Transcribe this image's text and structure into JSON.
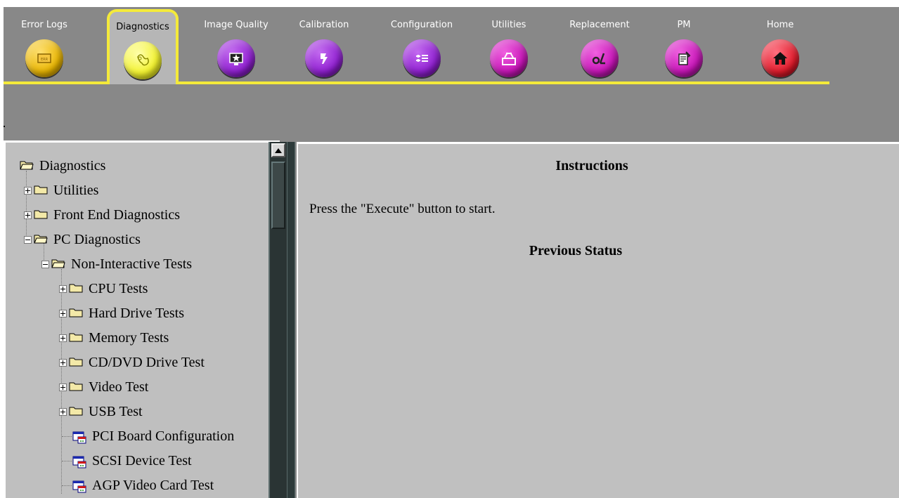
{
  "colors": {
    "accent_yellow": "#f4ea3a",
    "panel_gray": "#888888",
    "tree_bg": "#bfbfbf",
    "tab_orange": "#e8b400",
    "tab_active": "#f2f230",
    "tab_purple": "#8f1fd0",
    "tab_magenta": "#c614b6",
    "tab_red": "#e01a2a"
  },
  "tabs": [
    {
      "label": "Error Logs",
      "icon": "error-log-icon"
    },
    {
      "label": "Diagnostics",
      "icon": "diagnostics-icon",
      "active": true
    },
    {
      "label": "Image Quality",
      "icon": "image-quality-icon"
    },
    {
      "label": "Calibration",
      "icon": "calibration-icon"
    },
    {
      "label": "Configuration",
      "icon": "configuration-icon"
    },
    {
      "label": "Utilities",
      "icon": "utilities-icon"
    },
    {
      "label": "Replacement",
      "icon": "replacement-icon"
    },
    {
      "label": "PM",
      "icon": "pm-icon"
    },
    {
      "label": "Home",
      "icon": "home-icon"
    }
  ],
  "tree": {
    "root": "Diagnostics",
    "utilities": "Utilities",
    "front_end": "Front End Diagnostics",
    "pc_diag": "PC Diagnostics",
    "non_interactive": "Non-Interactive Tests",
    "cpu": "CPU Tests",
    "hdd": "Hard Drive Tests",
    "memory": "Memory Tests",
    "cddvd": "CD/DVD Drive Test",
    "video": "Video Test",
    "usb": "USB Test",
    "pci": "PCI Board Configuration",
    "scsi": "SCSI Device Test",
    "agp": "AGP Video Card Test"
  },
  "content": {
    "instructions_title": "Instructions",
    "instructions_text": "Press the \"Execute\" button to start.",
    "previous_status_title": "Previous Status"
  }
}
